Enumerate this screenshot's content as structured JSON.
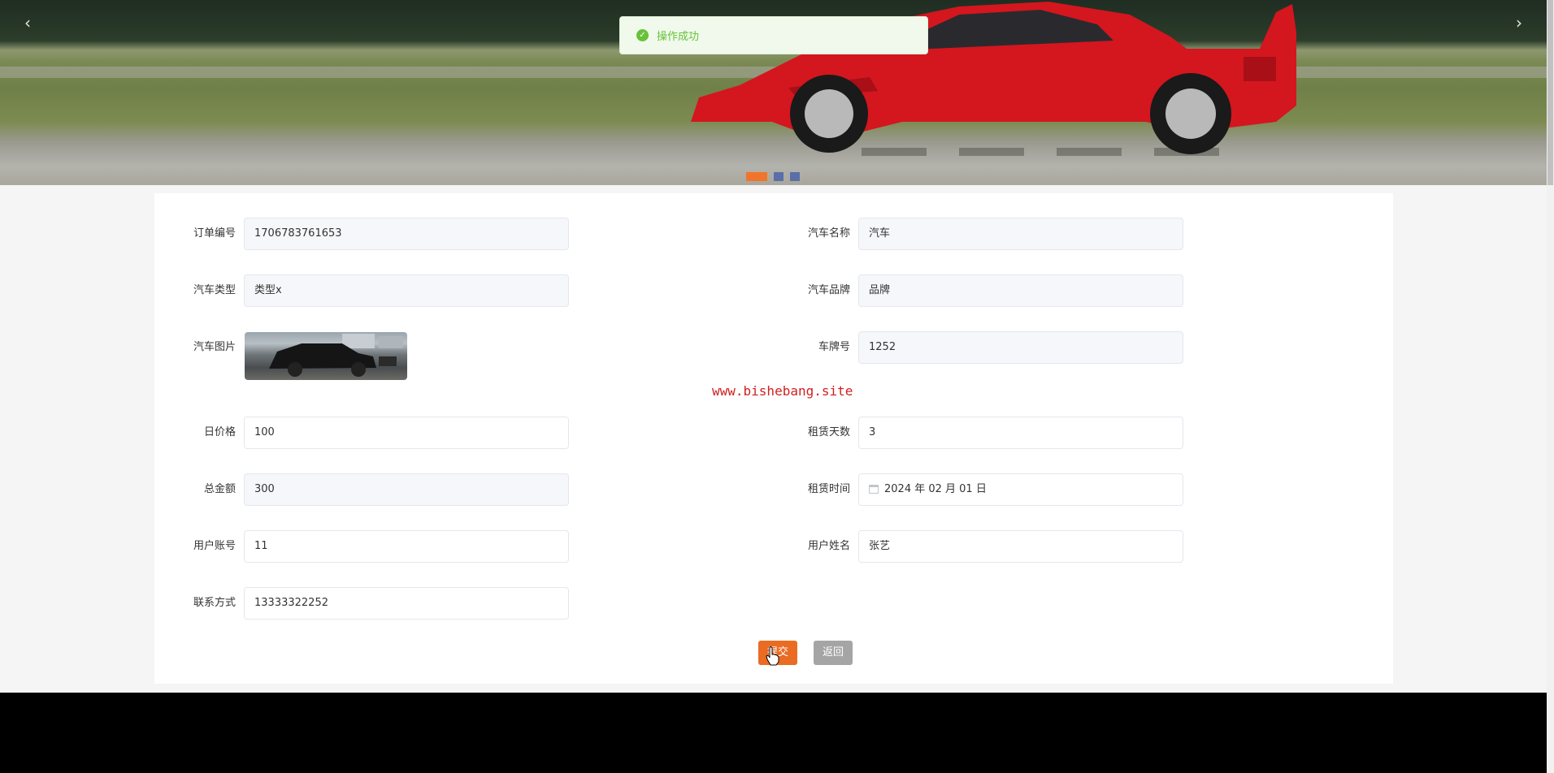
{
  "banner": {
    "prev_arrow": "‹",
    "next_arrow": "›",
    "slide_count": 3,
    "active_slide": 0
  },
  "toast": {
    "message": "操作成功",
    "type": "success"
  },
  "form": {
    "order_no": {
      "label": "订单编号",
      "value": "1706783761653"
    },
    "car_name": {
      "label": "汽车名称",
      "value": "汽车"
    },
    "car_type": {
      "label": "汽车类型",
      "value": "类型x"
    },
    "car_brand": {
      "label": "汽车品牌",
      "value": "品牌"
    },
    "car_image": {
      "label": "汽车图片"
    },
    "plate_no": {
      "label": "车牌号",
      "value": "1252"
    },
    "daily_price": {
      "label": "日价格",
      "value": "100"
    },
    "rent_days": {
      "label": "租赁天数",
      "value": "3"
    },
    "total_amount": {
      "label": "总金额",
      "value": "300"
    },
    "rent_time": {
      "label": "租赁时间",
      "value": "2024 年 02 月 01 日"
    },
    "user_account": {
      "label": "用户账号",
      "value": "11"
    },
    "user_name": {
      "label": "用户姓名",
      "value": "张艺"
    },
    "contact": {
      "label": "联系方式",
      "value": "13333322252"
    }
  },
  "watermark": "www.bishebang.site",
  "buttons": {
    "submit": "提交",
    "back": "返回"
  },
  "colors": {
    "accent": "#ea6b22",
    "success": "#67c23a",
    "back_button": "#a5a5a5"
  }
}
